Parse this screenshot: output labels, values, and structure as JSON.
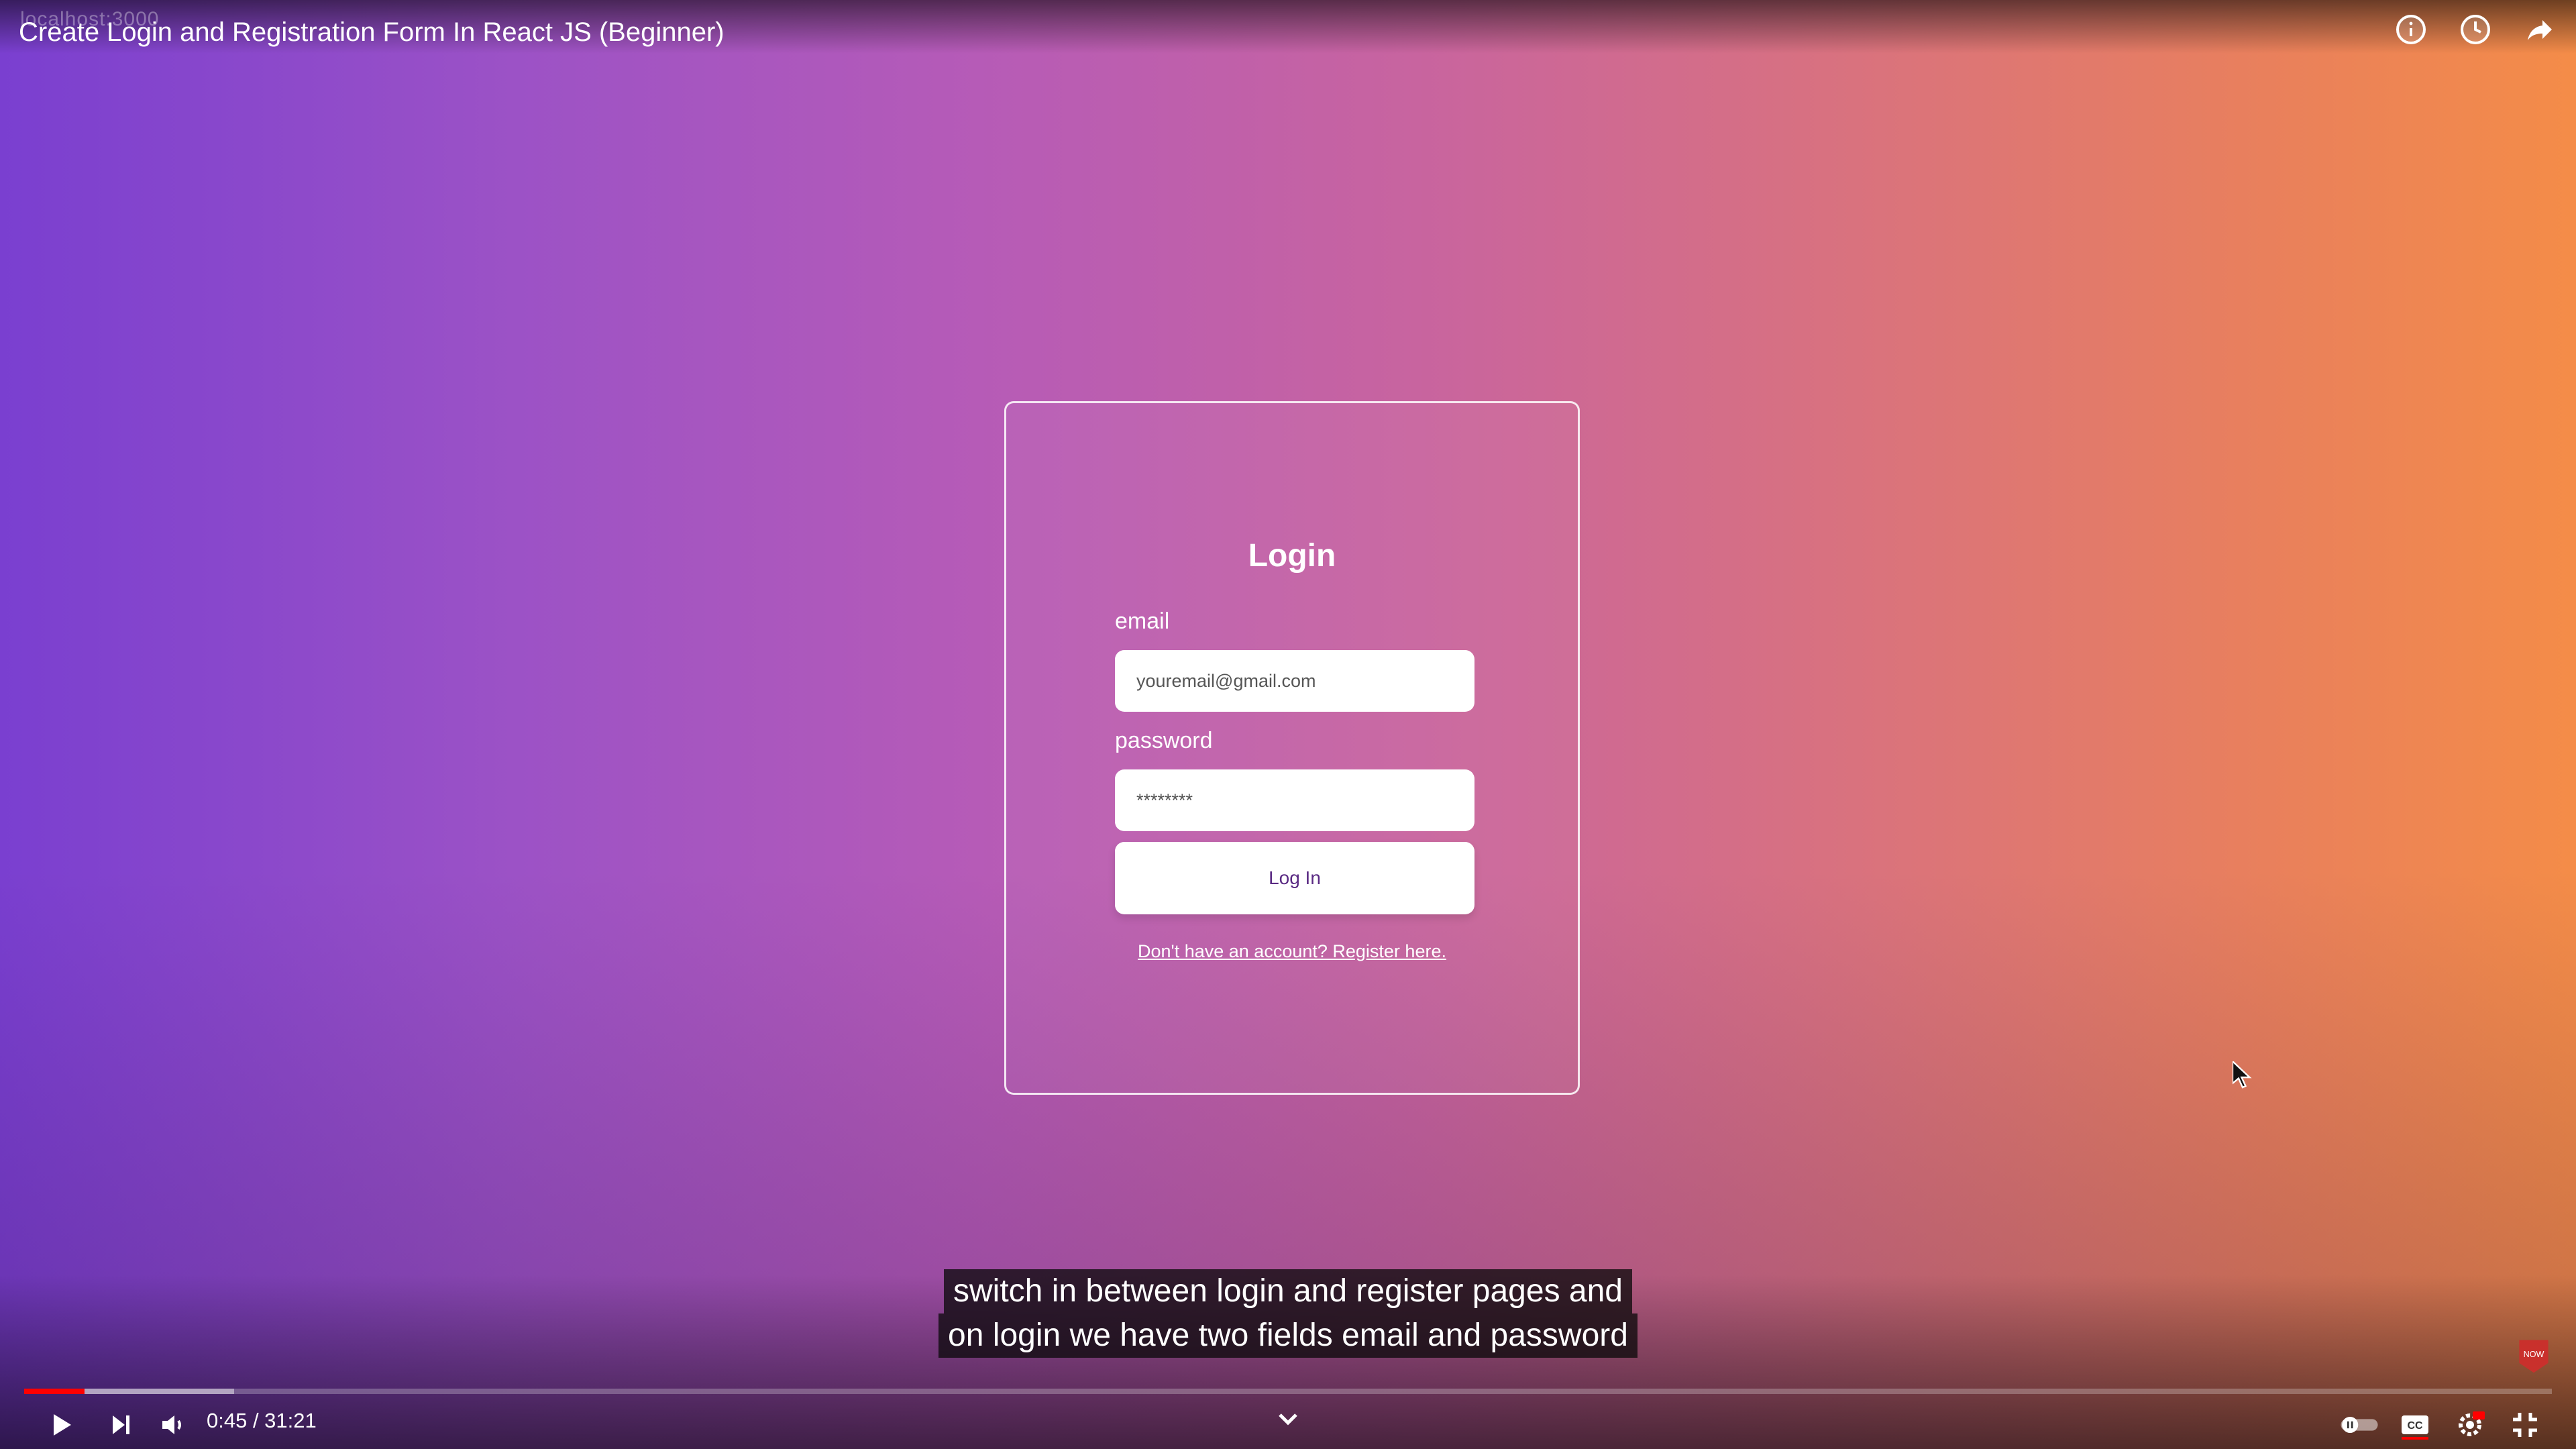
{
  "browser": {
    "url_ghost": "localhost:3000"
  },
  "video": {
    "title": "Create Login and Registration Form In React JS (Beginner)",
    "time_current": "0:45",
    "time_total": "31:21",
    "time_display": "0:45 / 31:21",
    "progress_played": 0.024,
    "progress_buffered": 0.083
  },
  "login": {
    "title": "Login",
    "email_label": "email",
    "email_placeholder": "youremail@gmail.com",
    "password_label": "password",
    "password_value": "********",
    "button_label": "Log In",
    "register_link": "Don't have an account? Register here."
  },
  "captions": {
    "line1": "switch in between login and register pages and",
    "line2": "on login we have two fields email and password"
  },
  "badge": {
    "text": "NOW"
  },
  "colors": {
    "gradient_left": "#7a3fd0",
    "gradient_mid": "#c8649f",
    "gradient_right": "#f48c48",
    "progress_played": "#ff0000",
    "button_text": "#5a2a83"
  },
  "icons": [
    "info-icon",
    "watch-later-icon",
    "share-icon",
    "play-icon",
    "next-icon",
    "volume-icon",
    "chapter-chevron-icon",
    "autoplay-toggle-icon",
    "captions-icon",
    "settings-icon",
    "exit-fullscreen-icon"
  ]
}
